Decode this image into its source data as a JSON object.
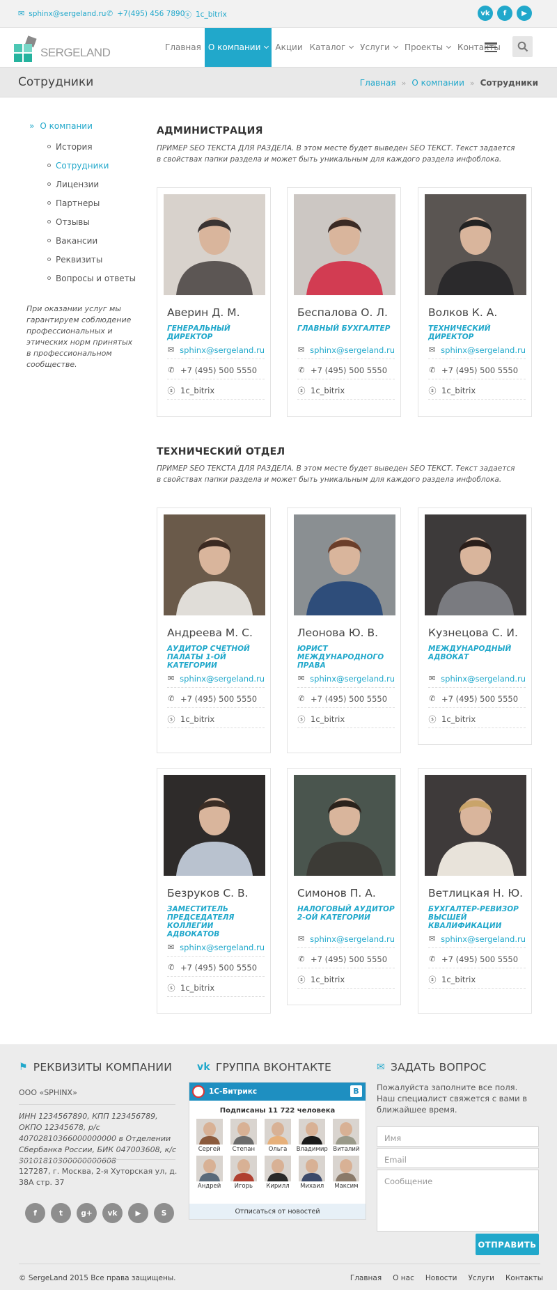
{
  "topbar": {
    "email": "sphinx@sergeland.ru",
    "phone": "+7(495) 456 7890",
    "skype": "1c_bitrix",
    "social": [
      "vk",
      "f",
      "▶"
    ]
  },
  "header": {
    "logo_text": "SERGELAND",
    "nav": [
      {
        "label": "Главная",
        "dropdown": false
      },
      {
        "label": "О компании",
        "dropdown": true,
        "active": true
      },
      {
        "label": "Акции",
        "dropdown": false
      },
      {
        "label": "Каталог",
        "dropdown": true
      },
      {
        "label": "Услуги",
        "dropdown": true
      },
      {
        "label": "Проекты",
        "dropdown": true
      },
      {
        "label": "Контакты",
        "dropdown": false
      }
    ]
  },
  "page": {
    "title": "Сотрудники",
    "breadcrumb": [
      "Главная",
      "О компании",
      "Сотрудники"
    ],
    "breadcrumb_sep": "»"
  },
  "sidebar": {
    "root_marker": "»",
    "root": "О компании",
    "items": [
      "История",
      "Сотрудники",
      "Лицензии",
      "Партнеры",
      "Отзывы",
      "Вакансии",
      "Реквизиты",
      "Вопросы и ответы"
    ],
    "active_index": 1,
    "note": "При оказании услуг мы гарантируем соблюдение профессиональных и этических норм принятых в профессиональном сообществе."
  },
  "sections": [
    {
      "title": "АДМИНИСТРАЦИЯ",
      "desc": "ПРИМЕР SEO ТЕКСТА ДЛЯ РАЗДЕЛА. В этом месте будет выведен SEO ТЕКСТ. Текст задается в свойствах папки раздела и может быть уникальным для каждого раздела инфоблока.",
      "people": [
        {
          "name": "Аверин Д. М.",
          "role": "ГЕНЕРАЛЬНЫЙ ДИРЕКТОР",
          "email": "sphinx@sergeland.ru",
          "phone": "+7 (495) 500 5550",
          "skype": "1c_bitrix"
        },
        {
          "name": "Беспалова О. Л.",
          "role": "ГЛАВНЫЙ БУХГАЛТЕР",
          "email": "sphinx@sergeland.ru",
          "phone": "+7 (495) 500 5550",
          "skype": "1c_bitrix"
        },
        {
          "name": "Волков К. А.",
          "role": "ТЕХНИЧЕСКИЙ ДИРЕКТОР",
          "email": "sphinx@sergeland.ru",
          "phone": "+7 (495) 500 5550",
          "skype": "1c_bitrix"
        }
      ]
    },
    {
      "title": "ТЕХНИЧЕСКИЙ ОТДЕЛ",
      "desc": "ПРИМЕР SEO ТЕКСТА ДЛЯ РАЗДЕЛА. В этом месте будет выведен SEO ТЕКСТ. Текст задается в свойствах папки раздела и может быть уникальным для каждого раздела инфоблока.",
      "people": [
        {
          "name": "Андреева М. С.",
          "role": "АУДИТОР СЧЕТНОЙ ПАЛАТЫ 1-ОЙ КАТЕГОРИИ",
          "email": "sphinx@sergeland.ru",
          "phone": "+7 (495) 500 5550",
          "skype": "1c_bitrix"
        },
        {
          "name": "Леонова Ю. В.",
          "role": "ЮРИСТ МЕЖДУНАРОДНОГО ПРАВА",
          "email": "sphinx@sergeland.ru",
          "phone": "+7 (495) 500 5550",
          "skype": "1c_bitrix"
        },
        {
          "name": "Кузнецова С. И.",
          "role": "МЕЖДУНАРОДНЫЙ АДВОКАТ",
          "email": "sphinx@sergeland.ru",
          "phone": "+7 (495) 500 5550",
          "skype": "1c_bitrix"
        },
        {
          "name": "Безруков С. В.",
          "role": "ЗАМЕСТИТЕЛЬ ПРЕДСЕДАТЕЛЯ КОЛЛЕГИИ АДВОКАТОВ",
          "email": "sphinx@sergeland.ru",
          "phone": "+7 (495) 500 5550",
          "skype": "1c_bitrix"
        },
        {
          "name": "Симонов П. А.",
          "role": "НАЛОГОВЫЙ АУДИТОР 2-ОЙ КАТЕГОРИИ",
          "email": "sphinx@sergeland.ru",
          "phone": "+7 (495) 500 5550",
          "skype": "1c_bitrix"
        },
        {
          "name": "Ветлицкая Н. Ю.",
          "role": "БУХГАЛТЕР-РЕВИЗОР ВЫСШЕЙ КВАЛИФИКАЦИИ",
          "email": "sphinx@sergeland.ru",
          "phone": "+7 (495) 500 5550",
          "skype": "1c_bitrix"
        }
      ]
    }
  ],
  "footer": {
    "requisites": {
      "title": "РЕКВИЗИТЫ КОМПАНИИ",
      "company": "ООО «SPHINX»",
      "details": "ИНН 1234567890, КПП 123456789, ОКПО 12345678, р/с 40702810366000000000 в Отделении Сбербанка России, БИК 047003608, к/с 30101810300000000608",
      "address": "127287, г. Москва, 2-я Хуторская ул, д. 38А стр. 37",
      "social": [
        "f",
        "t",
        "g+",
        "vk",
        "▶",
        "S"
      ]
    },
    "vk": {
      "title": "ГРУППА ВКОНТАКТЕ",
      "group_name": "1С-Битрикс",
      "badge": "В",
      "subscribers": "Подписаны 11 722 человека",
      "members": [
        "Сергей",
        "Степан",
        "Ольга",
        "Владимир",
        "Виталий",
        "Андрей",
        "Игорь",
        "Кирилл",
        "Михаил",
        "Максим"
      ],
      "unsubscribe": "Отписаться от новостей"
    },
    "question": {
      "title": "ЗАДАТЬ ВОПРОС",
      "text": "Пожалуйста заполните все поля. Наш специалист свяжется с вами в ближайшее время.",
      "name_placeholder": "Имя",
      "email_placeholder": "Email",
      "message_placeholder": "Сообщение",
      "send": "ОТПРАВИТЬ"
    },
    "copyright": "© SergeLand 2015 Все права защищены.",
    "links": [
      "Главная",
      "О нас",
      "Новости",
      "Услуги",
      "Контакты"
    ]
  },
  "colors": {
    "accent": "#21a8cb",
    "footer_bg": "#ececec",
    "titlebar_bg": "#e9e9e9"
  }
}
